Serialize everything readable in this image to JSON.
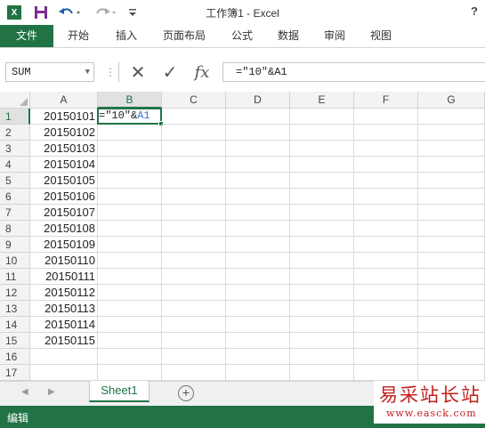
{
  "app": {
    "title": "工作簿1 - Excel",
    "logo": "X",
    "help": "?",
    "quick_access": [
      "save-icon",
      "undo-icon",
      "redo-icon",
      "customize-icon"
    ]
  },
  "ribbon": {
    "tabs": [
      "文件",
      "开始",
      "插入",
      "页面布局",
      "公式",
      "数据",
      "审阅",
      "视图"
    ]
  },
  "formula_bar": {
    "name_box": "SUM",
    "cancel_glyph": "✕",
    "enter_glyph": "✓",
    "fx_label": "fx",
    "formula": "=\"10\"&A1"
  },
  "sheet": {
    "columns": [
      "A",
      "B",
      "C",
      "D",
      "E",
      "F",
      "G"
    ],
    "rows": [
      "1",
      "2",
      "3",
      "4",
      "5",
      "6",
      "7",
      "8",
      "9",
      "10",
      "11",
      "12",
      "13",
      "14",
      "15",
      "16",
      "17"
    ],
    "colA": [
      "20150101",
      "20150102",
      "20150103",
      "20150104",
      "20150105",
      "20150106",
      "20150107",
      "20150108",
      "20150109",
      "20150110",
      "20150111",
      "20150112",
      "20150113",
      "20150114",
      "20150115",
      "",
      ""
    ],
    "active_cell": {
      "text_prefix": "=\"10\"&",
      "text_ref": "A1"
    }
  },
  "sheet_tabs": {
    "active": "Sheet1",
    "add": "+"
  },
  "status_bar": {
    "mode": "编辑"
  },
  "watermark": {
    "title": "易采站长站",
    "url": "www.easck.com"
  },
  "colors": {
    "accent": "#217346",
    "ref_blue": "#4472c4",
    "watermark_red": "#c0201f"
  }
}
